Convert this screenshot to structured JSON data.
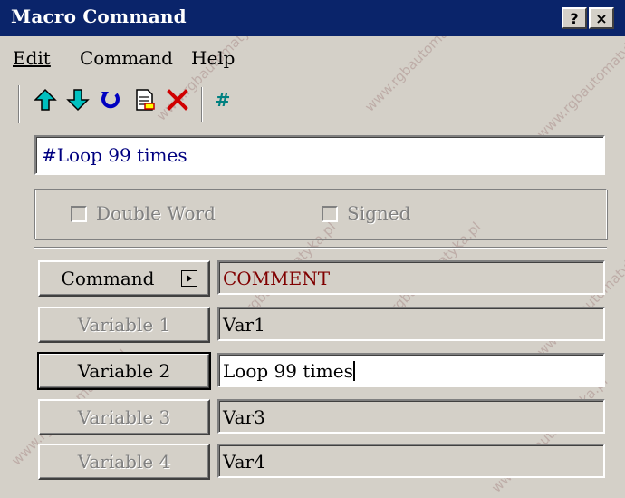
{
  "window": {
    "title": "Macro Command",
    "help_button": "?",
    "close_button": "×"
  },
  "menu": [
    {
      "label": "Edit"
    },
    {
      "label": "Command"
    },
    {
      "label": "Help"
    }
  ],
  "toolbar": {
    "icons": [
      "move-up-icon",
      "move-down-icon",
      "refresh-icon",
      "document-icon",
      "delete-icon",
      "comment-icon"
    ],
    "comment_glyph": "#"
  },
  "comment_field": {
    "value": "#Loop 99 times"
  },
  "options": {
    "double_word": {
      "label": "Double Word",
      "checked": false,
      "enabled": false
    },
    "signed": {
      "label": "Signed",
      "checked": false,
      "enabled": false
    }
  },
  "command": {
    "button_label": "Command",
    "value": "COMMENT",
    "value_color": "#800000"
  },
  "variables": [
    {
      "button_label": "Variable 1",
      "value": "Var1",
      "enabled": false
    },
    {
      "button_label": "Variable 2",
      "value": "Loop 99 times",
      "enabled": true
    },
    {
      "button_label": "Variable 3",
      "value": "Var3",
      "enabled": false
    },
    {
      "button_label": "Variable 4",
      "value": "Var4",
      "enabled": false
    }
  ],
  "watermark": "www.rgbautomatyka.pl",
  "colors": {
    "title_bar": "#0a246a",
    "dialog_bg": "#d4d0c8",
    "arrow_cyan": "#00a0a0",
    "refresh_blue": "#0000c0",
    "delete_red": "#c00000",
    "comment_teal": "#008080"
  }
}
